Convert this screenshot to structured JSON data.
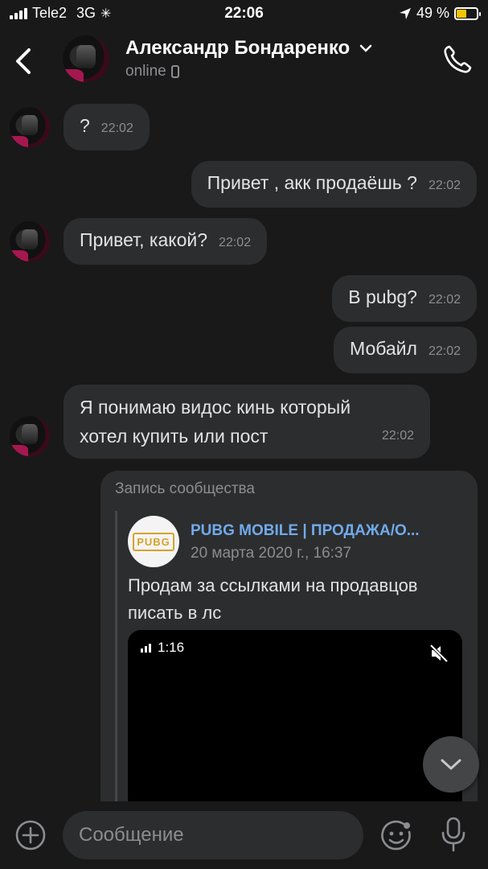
{
  "status_bar": {
    "carrier": "Tele2",
    "network": "3G",
    "time": "22:06",
    "battery": "49 %",
    "battery_level": 0.49,
    "icons": [
      "signal-icon",
      "activity-spinner-icon",
      "location-arrow-icon",
      "battery-icon"
    ]
  },
  "header": {
    "name": "Александр Бондаренко",
    "status": "online",
    "icons": [
      "back-chevron-icon",
      "dropdown-chevron-icon",
      "mobile-device-icon",
      "phone-call-icon"
    ]
  },
  "messages": [
    {
      "dir": "in",
      "text": "?",
      "time": "22:02"
    },
    {
      "dir": "out",
      "text": "Привет , акк продаёшь ?",
      "time": "22:02"
    },
    {
      "dir": "in",
      "text": "Привет, какой?",
      "time": "22:02"
    },
    {
      "dir": "out",
      "text": "В pubg?",
      "time": "22:02"
    },
    {
      "dir": "out",
      "text": "Мобайл",
      "time": "22:02"
    },
    {
      "dir": "in",
      "text_line1": "Я понимаю видос кинь который",
      "text_line2": "хотел купить или пост",
      "time": "22:02"
    }
  ],
  "repost": {
    "label": "Запись сообщества",
    "group_name": "PUBG MOBILE | ПРОДАЖА/О...",
    "logo_text": "PUBG",
    "date": "20 марта 2020 г., 16:37",
    "text_line1": "Продам за ссылками на продавцов",
    "text_line2": "писать в лс",
    "video_duration": "1:16",
    "video_icons": [
      "bars-icon",
      "muted-speaker-icon"
    ]
  },
  "composer": {
    "placeholder": "Сообщение",
    "icons": [
      "add-attachment-icon",
      "emoji-sticker-icon",
      "microphone-icon",
      "scroll-down-chevron-icon"
    ]
  },
  "colors": {
    "background": "#19191a",
    "bubble": "#2c2d2e",
    "link": "#71aaeb",
    "secondary_text": "#8b8d91",
    "battery": "#f5c400"
  }
}
